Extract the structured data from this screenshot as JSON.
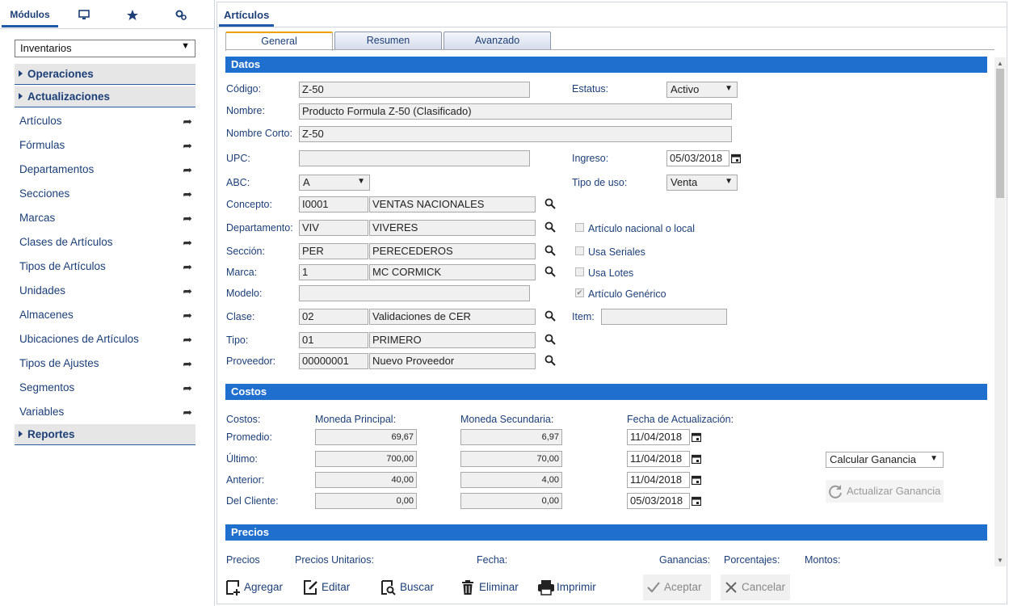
{
  "left": {
    "tabs": {
      "modulos": "Módulos"
    },
    "module_select": "Inventarios",
    "sections": {
      "operaciones": "Operaciones",
      "actualizaciones": "Actualizaciones",
      "reportes": "Reportes"
    },
    "items": [
      "Artículos",
      "Fórmulas",
      "Departamentos",
      "Secciones",
      "Marcas",
      "Clases de Artículos",
      "Tipos de Artículos",
      "Unidades",
      "Almacenes",
      "Ubicaciones de Artículos",
      "Tipos de Ajustes",
      "Segmentos",
      "Variables"
    ]
  },
  "right": {
    "tab": "Artículos",
    "form_tabs": {
      "general": "General",
      "resumen": "Resumen",
      "avanzado": "Avanzado"
    },
    "datos": {
      "header": "Datos",
      "codigo_label": "Código:",
      "codigo": "Z-50",
      "nombre_label": "Nombre:",
      "nombre": "Producto Formula Z-50 (Clasificado)",
      "nombre_corto_label": "Nombre Corto:",
      "nombre_corto": "Z-50",
      "upc_label": "UPC:",
      "upc": "",
      "abc_label": "ABC:",
      "abc": "A",
      "concepto_label": "Concepto:",
      "concepto_code": "I0001",
      "concepto_desc": "VENTAS NACIONALES",
      "departamento_label": "Departamento:",
      "departamento_code": "VIV",
      "departamento_desc": "VIVERES",
      "seccion_label": "Sección:",
      "seccion_code": "PER",
      "seccion_desc": "PERECEDEROS",
      "marca_label": "Marca:",
      "marca_code": "1",
      "marca_desc": "MC CORMICK",
      "modelo_label": "Modelo:",
      "modelo": "",
      "clase_label": "Clase:",
      "clase_code": "02",
      "clase_desc": "Validaciones de CER",
      "tipo_label": "Tipo:",
      "tipo_code": "01",
      "tipo_desc": "PRIMERO",
      "proveedor_label": "Proveedor:",
      "proveedor_code": "00000001",
      "proveedor_desc": "Nuevo Proveedor",
      "estatus_label": "Estatus:",
      "estatus": "Activo",
      "ingreso_label": "Ingreso:",
      "ingreso": "05/03/2018",
      "tipo_uso_label": "Tipo de uso:",
      "tipo_uso": "Venta",
      "chk_nacional": "Artículo nacional o local",
      "chk_seriales": "Usa Seriales",
      "chk_lotes": "Usa Lotes",
      "chk_generico": "Artículo Genérico",
      "item_label": "Item:",
      "item": ""
    },
    "costos": {
      "header": "Costos",
      "col_costos": "Costos:",
      "col_principal": "Moneda Principal:",
      "col_secundaria": "Moneda Secundaria:",
      "col_fecha": "Fecha de Actualización:",
      "rows": [
        {
          "label": "Promedio:",
          "principal": "69,67",
          "secundaria": "6,97",
          "fecha": "11/04/2018"
        },
        {
          "label": "Último:",
          "principal": "700,00",
          "secundaria": "70,00",
          "fecha": "11/04/2018"
        },
        {
          "label": "Anterior:",
          "principal": "40,00",
          "secundaria": "4,00",
          "fecha": "11/04/2018"
        },
        {
          "label": "Del Cliente:",
          "principal": "0,00",
          "secundaria": "0,00",
          "fecha": "05/03/2018"
        }
      ],
      "calcular": "Calcular Ganancia",
      "actualizar": "Actualizar Ganancia"
    },
    "precios": {
      "header": "Precios",
      "col_precios": "Precios",
      "col_unitarios": "Precios Unitarios:",
      "col_fecha": "Fecha:",
      "col_ganancias": "Ganancias:",
      "col_porcentajes": "Porcentajes:",
      "col_montos": "Montos:"
    },
    "toolbar": {
      "agregar": "Agregar",
      "editar": "Editar",
      "buscar": "Buscar",
      "eliminar": "Eliminar",
      "imprimir": "Imprimir",
      "aceptar": "Aceptar",
      "cancelar": "Cancelar"
    }
  },
  "colors": {
    "accent": "#1f6fcf",
    "nav_text": "#1c3f78",
    "tab_active": "#f0a000"
  }
}
